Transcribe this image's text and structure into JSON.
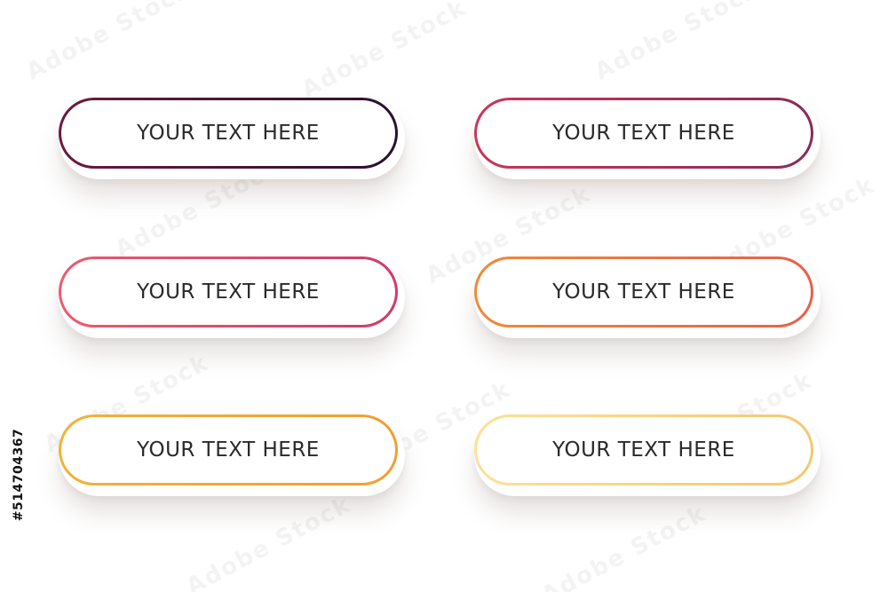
{
  "watermark": {
    "text": "Adobe Stock"
  },
  "stock_id": "#514704367",
  "buttons": [
    {
      "label": "YOUR TEXT HERE",
      "color_start": "#6d1a3f",
      "color_end": "#2a1030"
    },
    {
      "label": "YOUR TEXT HERE",
      "color_start": "#c8375a",
      "color_end": "#8a2a58"
    },
    {
      "label": "YOUR TEXT HERE",
      "color_start": "#ee5a6e",
      "color_end": "#d23a6a"
    },
    {
      "label": "YOUR TEXT HERE",
      "color_start": "#f08a3a",
      "color_end": "#e8604a"
    },
    {
      "label": "YOUR TEXT HERE",
      "color_start": "#f2b23a",
      "color_end": "#f0a030"
    },
    {
      "label": "YOUR TEXT HERE",
      "color_start": "#fbe19a",
      "color_end": "#f5c870"
    }
  ]
}
